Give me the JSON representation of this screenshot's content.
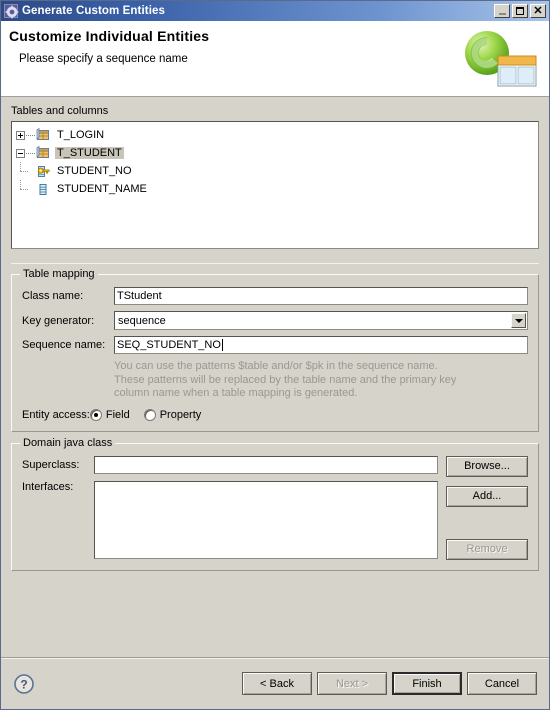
{
  "window": {
    "title": "Generate Custom Entities",
    "icon": "gear-icon",
    "controls": {
      "minimize": "minimize-icon",
      "maximize": "maximize-icon",
      "close": "close-icon"
    }
  },
  "banner": {
    "title": "Customize Individual Entities",
    "subtitle": "Please specify a sequence name",
    "art": "entity-wizard-logo"
  },
  "tree_section": {
    "label": "Tables and columns",
    "nodes": [
      {
        "label": "T_LOGIN",
        "icon": "table-icon",
        "expander": "plus",
        "level": 0,
        "selected": false
      },
      {
        "label": "T_STUDENT",
        "icon": "table-icon",
        "expander": "minus",
        "level": 0,
        "selected": true
      },
      {
        "label": "STUDENT_NO",
        "icon": "key-column-icon",
        "expander": "none",
        "level": 1,
        "selected": false
      },
      {
        "label": "STUDENT_NAME",
        "icon": "column-icon",
        "expander": "none",
        "level": 1,
        "selected": false
      }
    ]
  },
  "table_mapping": {
    "title": "Table mapping",
    "class_name_label": "Class name:",
    "class_name_value": "TStudent",
    "key_generator_label": "Key generator:",
    "key_generator_value": "sequence",
    "key_generator_options": [
      "sequence"
    ],
    "sequence_name_label": "Sequence name:",
    "sequence_name_value": "SEQ_STUDENT_NO",
    "hint_line1": "You can use the patterns $table and/or $pk in the sequence name.",
    "hint_line2": "These patterns will be replaced by the table name and the primary key",
    "hint_line3": "column name when a table mapping is generated.",
    "entity_access_label": "Entity access:",
    "entity_access_options": [
      {
        "label": "Field",
        "selected": true
      },
      {
        "label": "Property",
        "selected": false
      }
    ]
  },
  "domain_java_class": {
    "title": "Domain java class",
    "superclass_label": "Superclass:",
    "superclass_value": "",
    "interfaces_label": "Interfaces:",
    "interfaces_value": "",
    "browse_label": "Browse...",
    "add_label": "Add...",
    "remove_label": "Remove",
    "remove_enabled": false
  },
  "footer": {
    "help": "help-icon",
    "buttons": [
      {
        "label": "< Back",
        "enabled": true,
        "default": false
      },
      {
        "label": "Next >",
        "enabled": false,
        "default": false
      },
      {
        "label": "Finish",
        "enabled": true,
        "default": true
      },
      {
        "label": "Cancel",
        "enabled": true,
        "default": false
      }
    ]
  },
  "colors": {
    "dialog_bg": "#d6d3ca",
    "title_bar_start": "#2c4a87",
    "title_bar_end": "#a9c4e8",
    "selection": "#c8c4b8",
    "hint_text": "#9a9892",
    "field_bg": "#ffffff"
  }
}
